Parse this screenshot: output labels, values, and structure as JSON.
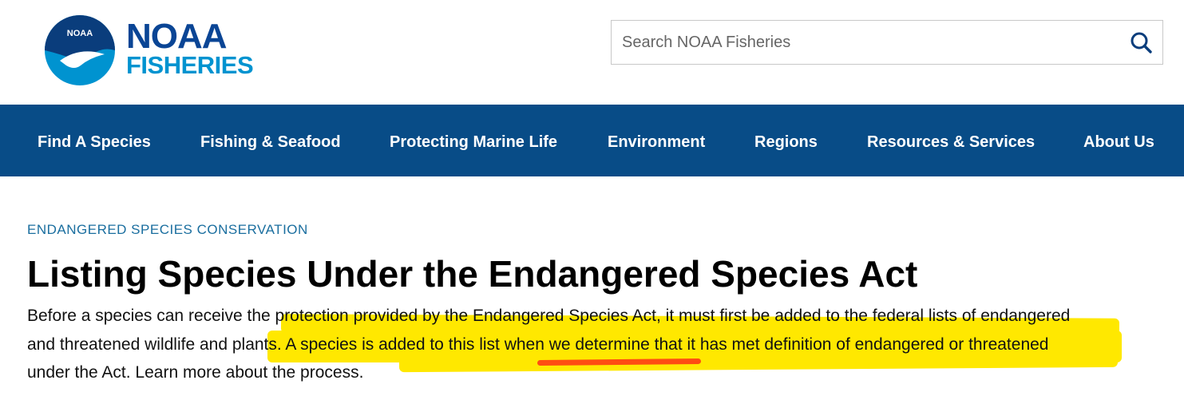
{
  "logo": {
    "emblem_text": "NOAA",
    "line1": "NOAA",
    "line2": "FISHERIES"
  },
  "search": {
    "placeholder": "Search NOAA Fisheries"
  },
  "nav": {
    "items": [
      {
        "label": "Find A Species"
      },
      {
        "label": "Fishing & Seafood"
      },
      {
        "label": "Protecting Marine Life"
      },
      {
        "label": "Environment"
      },
      {
        "label": "Regions"
      },
      {
        "label": "Resources & Services"
      },
      {
        "label": "About Us"
      }
    ]
  },
  "page": {
    "eyebrow": "ENDANGERED SPECIES CONSERVATION",
    "title": "Listing Species Under the Endangered Species Act",
    "body_lines": [
      "Before a species can receive the protection provided by the Endangered Species Act, it must first be added to the federal lists of endangered",
      "and threatened wildlife and plants. A species is added to this list when we determine that it has met definition of endangered or threatened",
      "under the Act. Learn more about the process."
    ]
  },
  "annotations": {
    "highlight_color": "#ffe800",
    "underline_color": "#ff4d12"
  },
  "colors": {
    "nav_bg": "#084c87",
    "logo_dark": "#0a4595",
    "logo_light": "#0093d0",
    "eyebrow": "#1a6e9f"
  }
}
